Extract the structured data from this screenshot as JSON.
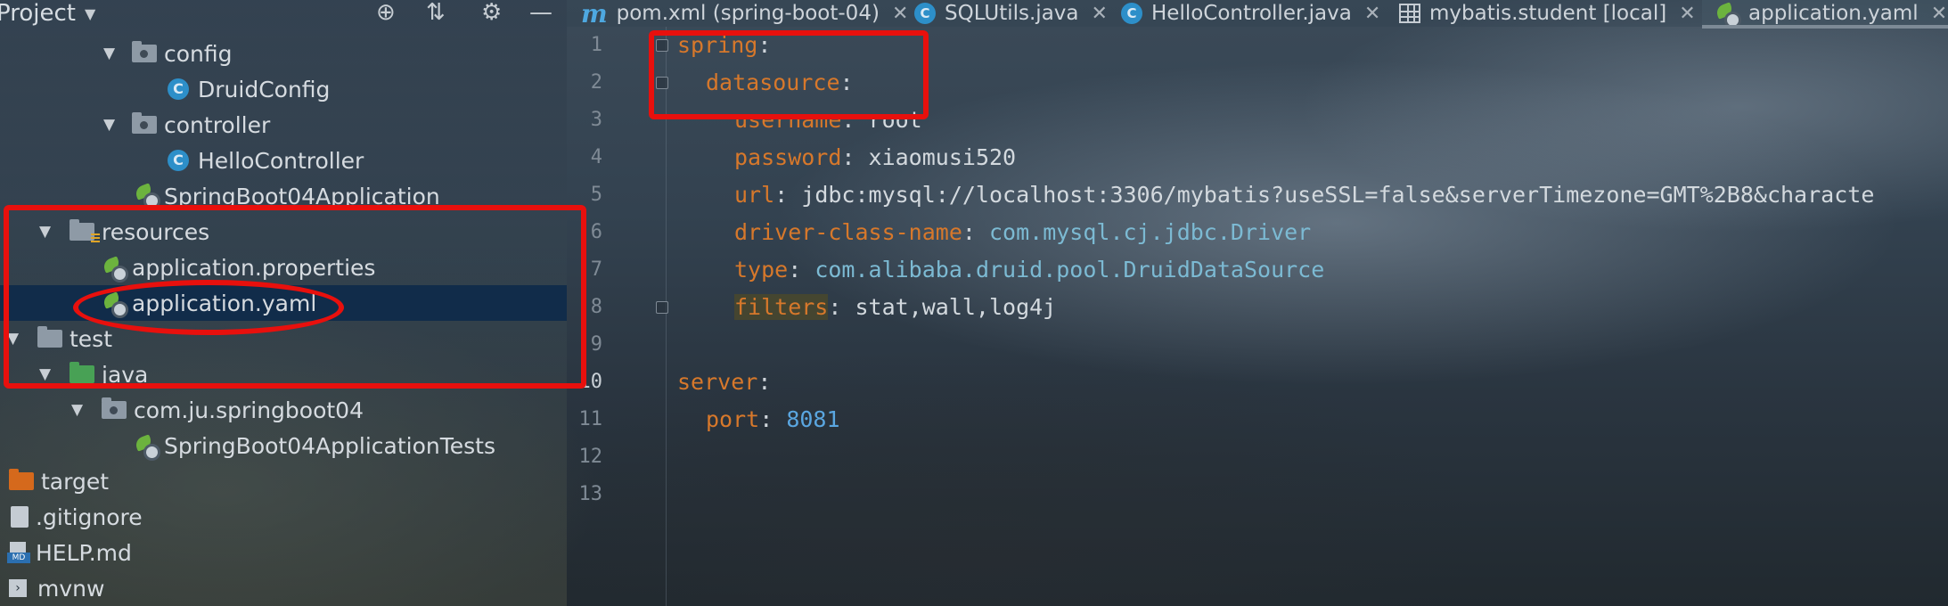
{
  "project_panel": {
    "title": "Project",
    "tree": [
      {
        "label": "config",
        "kind": "package",
        "indent": 2,
        "expanded": true
      },
      {
        "label": "DruidConfig",
        "kind": "class",
        "indent": 3
      },
      {
        "label": "controller",
        "kind": "package",
        "indent": 2,
        "expanded": true
      },
      {
        "label": "HelloController",
        "kind": "class",
        "indent": 3
      },
      {
        "label": "SpringBoot04Application",
        "kind": "spring-class",
        "indent": 3
      },
      {
        "label": "resources",
        "kind": "resources-folder",
        "indent": 1,
        "expanded": true
      },
      {
        "label": "application.properties",
        "kind": "spring-config",
        "indent": 2
      },
      {
        "label": "application.yaml",
        "kind": "spring-config",
        "indent": 2,
        "selected": true
      },
      {
        "label": "test",
        "kind": "folder",
        "indent": 0,
        "expanded": true
      },
      {
        "label": "java",
        "kind": "green-folder",
        "indent": 1,
        "expanded": true
      },
      {
        "label": "com.ju.springboot04",
        "kind": "package",
        "indent": 2,
        "expanded": true
      },
      {
        "label": "SpringBoot04ApplicationTests",
        "kind": "spring-class",
        "indent": 3
      },
      {
        "label": "target",
        "kind": "orange-folder",
        "indent": 0
      },
      {
        "label": ".gitignore",
        "kind": "file",
        "indent": 0
      },
      {
        "label": "HELP.md",
        "kind": "markdown",
        "indent": 0
      },
      {
        "label": "mvnw",
        "kind": "executable",
        "indent": 0
      }
    ]
  },
  "tabs": [
    {
      "label": "pom.xml (spring-boot-04)",
      "icon": "maven-icon"
    },
    {
      "label": "SQLUtils.java",
      "icon": "java-class-icon"
    },
    {
      "label": "HelloController.java",
      "icon": "java-class-icon"
    },
    {
      "label": "mybatis.student [local]",
      "icon": "table-icon"
    },
    {
      "label": "application.yaml",
      "icon": "spring-config-icon",
      "active": true
    }
  ],
  "editor": {
    "line_numbers": [
      "1",
      "2",
      "3",
      "4",
      "5",
      "6",
      "7",
      "8",
      "9",
      "10",
      "11",
      "12",
      "13"
    ],
    "current_line": "10",
    "lines": [
      {
        "key": "spring",
        "sep": ":",
        "value": ""
      },
      {
        "key": "datasource",
        "sep": ":",
        "value": ""
      },
      {
        "key": "username",
        "sep": ": ",
        "value": "root"
      },
      {
        "key": "password",
        "sep": ": ",
        "value": "xiaomusi520"
      },
      {
        "key": "url",
        "sep": ": ",
        "value": "jdbc:mysql://localhost:3306/mybatis?useSSL=false&serverTimezone=GMT%2B8&characte"
      },
      {
        "key": "driver-class-name",
        "sep": ": ",
        "value_pkg": "com.mysql.cj.jdbc.",
        "value_cls": "Driver"
      },
      {
        "key": "type",
        "sep": ": ",
        "value_pkg": "com.alibaba.druid.pool.",
        "value_cls": "DruidDataSource"
      },
      {
        "key": "filters",
        "sep": ": ",
        "value": "stat,wall,log4j"
      },
      {
        "key": "",
        "sep": "",
        "value": ""
      },
      {
        "key": "server",
        "sep": ":",
        "value": ""
      },
      {
        "key": "port",
        "sep": ": ",
        "value": "8081"
      },
      {
        "key": "",
        "sep": "",
        "value": ""
      },
      {
        "key": "",
        "sep": "",
        "value": ""
      }
    ]
  },
  "colors": {
    "annotation_red": "#e8100d",
    "yaml_key": "#d7782b",
    "number": "#5aa6e0",
    "selection": "#0e2a4a"
  }
}
